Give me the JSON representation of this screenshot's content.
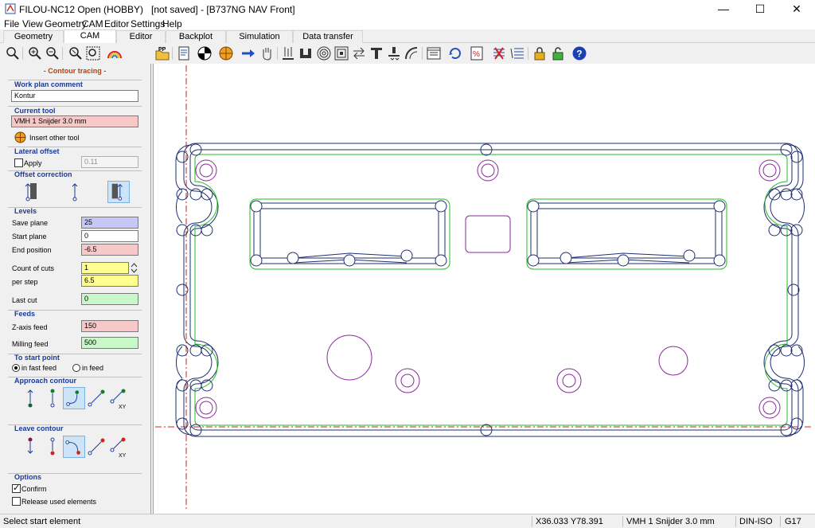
{
  "window": {
    "title": "FILOU-NC12 Open (HOBBY)   [not saved] - [B737NG NAV Front]",
    "minimize": "—",
    "maximize": "☐",
    "close": "✕"
  },
  "menu": [
    "File",
    "View",
    "Geometry",
    "CAM",
    "Editor",
    "Settings",
    "Help"
  ],
  "tabs": [
    "Geometry",
    "CAM",
    "Editor",
    "Backplot",
    "Simulation",
    "Data transfer"
  ],
  "active_tab": "CAM",
  "panel": {
    "title": "- Contour tracing -",
    "work_plan_comment": {
      "label": "Work plan comment",
      "value": "Kontur"
    },
    "current_tool": {
      "label": "Current tool",
      "value": "VMH 1 Snijder 3.0 mm",
      "insert_label": "Insert other tool"
    },
    "lateral_offset": {
      "label": "Lateral offset",
      "apply_label": "Apply",
      "apply_checked": false,
      "value": "0.11"
    },
    "offset_correction": {
      "label": "Offset correction"
    },
    "levels": {
      "label": "Levels",
      "save_plane": {
        "label": "Save plane",
        "value": "25",
        "color": "#c8c8f8"
      },
      "start_plane": {
        "label": "Start plane",
        "value": "0",
        "color": "#ffffff"
      },
      "end_position": {
        "label": "End position",
        "value": "-6.5",
        "color": "#f8c8c8"
      },
      "count_of_cuts": {
        "label": "Count of cuts",
        "value": "1",
        "color": "#ffff90"
      },
      "per_step": {
        "label": "per step",
        "value": "6.5",
        "color": "#ffff90"
      },
      "last_cut": {
        "label": "Last cut",
        "value": "0",
        "color": "#c8f8c8"
      }
    },
    "feeds": {
      "label": "Feeds",
      "z_axis": {
        "label": "Z-axis feed",
        "value": "150",
        "color": "#f8c8c8"
      },
      "milling": {
        "label": "Milling feed",
        "value": "500",
        "color": "#c8f8c8"
      }
    },
    "to_start_point": {
      "label": "To start point",
      "fast_label": "in fast feed",
      "feed_label": "in feed",
      "selected": "fast"
    },
    "approach_contour": {
      "label": "Approach contour",
      "xy": "XY"
    },
    "leave_contour": {
      "label": "Leave contour",
      "xy": "XY"
    },
    "options": {
      "label": "Options",
      "confirm": {
        "label": "Confirm",
        "checked": true
      },
      "release": {
        "label": "Release used elements",
        "checked": false
      }
    }
  },
  "toolbar": {
    "pp_label": "PP"
  },
  "status": {
    "message": "Select start element",
    "coords": "X36.033 Y78.391",
    "tool": "VMH 1 Snijder 3.0 mm",
    "mode": "DIN-ISO",
    "code": "G17"
  },
  "colors": {
    "contour": "#1f2f6f",
    "offset": "#22bb22",
    "holes": "#8a2a9a",
    "axis": "#cc2222"
  }
}
